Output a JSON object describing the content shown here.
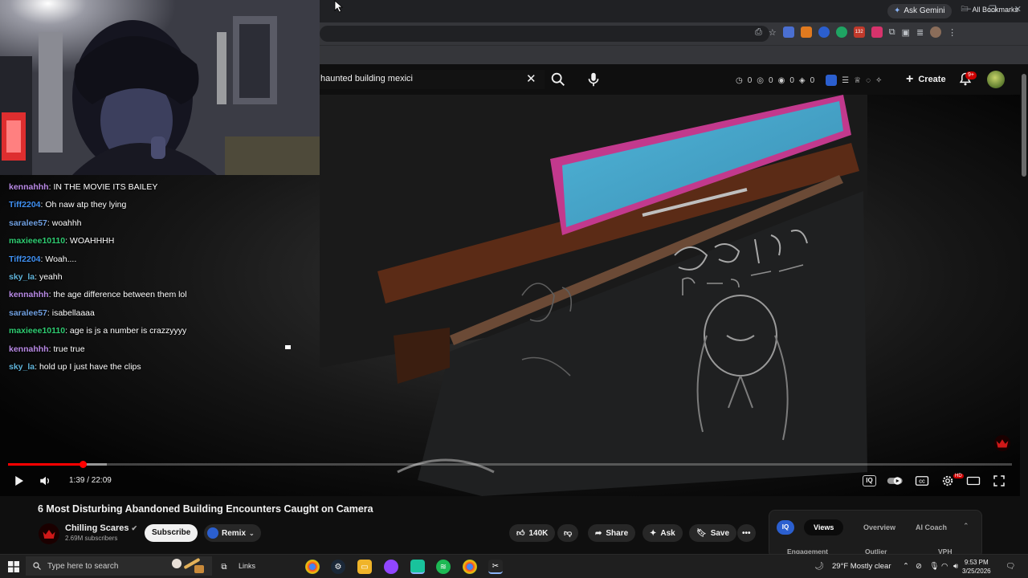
{
  "browser": {
    "ask_gemini_label": "Ask Gemini",
    "all_bookmarks_label": "All Bookmarks",
    "extension_badge": "132"
  },
  "youtube": {
    "search_value": "haunted building mexici",
    "stats": [
      "0",
      "0",
      "0",
      "0"
    ],
    "create_label": "Create",
    "notification_badge": "9+"
  },
  "player": {
    "time_display": "1:39 / 22:09",
    "progress_fraction": 0.0747,
    "buffer_fraction": 0.098
  },
  "chat": [
    {
      "user": "kennahhh",
      "message": "IN THE MOVIE ITS BAILEY",
      "color": "#b98ae6"
    },
    {
      "user": "Tiff2204",
      "message": "Oh naw atp they lying",
      "color": "#3f8ff0"
    },
    {
      "user": "saralee57",
      "message": "woahhh",
      "color": "#6f9fe0"
    },
    {
      "user": "maxieee10110",
      "message": "WOAHHHH",
      "color": "#2ecc71"
    },
    {
      "user": "Tiff2204",
      "message": "Woah....",
      "color": "#3f8ff0"
    },
    {
      "user": "sky_la",
      "message": "yeahh",
      "color": "#5fb3d9"
    },
    {
      "user": "kennahhh",
      "message": "the age difference between them lol",
      "color": "#b98ae6"
    },
    {
      "user": "saralee57",
      "message": "isabellaaaa",
      "color": "#6f9fe0"
    },
    {
      "user": "maxieee10110",
      "message": "age is js a number is crazzyyyy",
      "color": "#2ecc71"
    },
    {
      "user": "kennahhh",
      "message": "true true",
      "color": "#b98ae6"
    },
    {
      "user": "sky_la",
      "message": "hold up I just have the clips",
      "color": "#5fb3d9"
    }
  ],
  "video": {
    "title": "6 Most Disturbing Abandoned Building Encounters Caught on Camera",
    "channel_name": "Chilling Scares",
    "channel_subscribers": "2.69M subscribers",
    "subscribe_label": "Subscribe",
    "remix_label": "Remix",
    "like_count": "140K",
    "share_label": "Share",
    "ask_label": "Ask",
    "save_label": "Save"
  },
  "iq_panel": {
    "badge": "IQ",
    "tabs": [
      "Views",
      "Overview",
      "AI Coach"
    ],
    "active_tab": "Views",
    "columns": [
      "Engagement",
      "Outlier",
      "VPH"
    ]
  },
  "taskbar": {
    "search_placeholder": "Type here to search",
    "links_label": "Links",
    "weather": "29°F  Mostly clear",
    "time": "9:53 PM",
    "date": "3/25/2026"
  },
  "colors": {
    "youtube_red": "#ff0000",
    "chat_kennahhh": "#b98ae6",
    "chat_tiff": "#3f8ff0",
    "chat_maxie": "#2ecc71"
  }
}
